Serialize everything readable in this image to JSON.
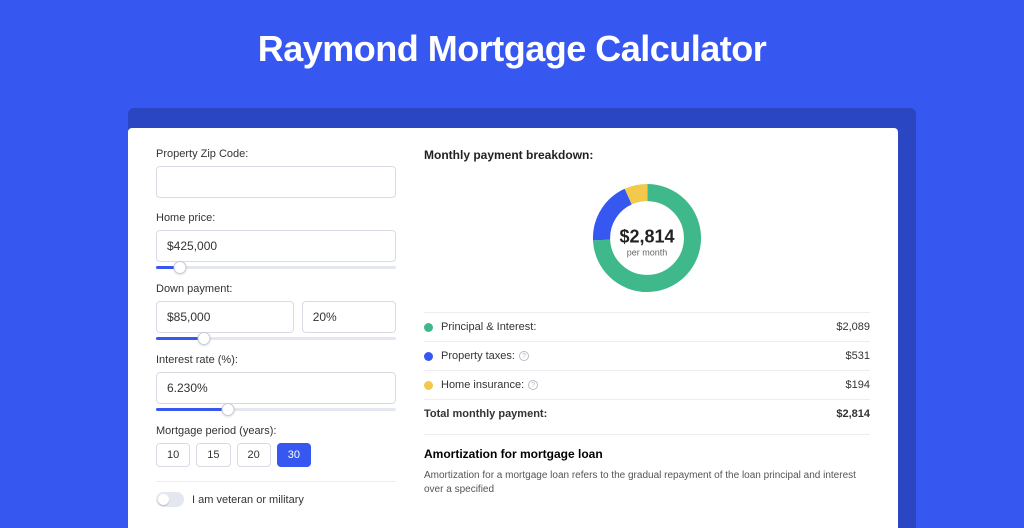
{
  "title": "Raymond Mortgage Calculator",
  "colors": {
    "accent": "#3657f0",
    "principal": "#3fb98b",
    "taxes": "#3657f0",
    "insurance": "#f3c94c"
  },
  "form": {
    "zip_label": "Property Zip Code:",
    "zip_value": "",
    "home_price_label": "Home price:",
    "home_price_value": "$425,000",
    "home_price_slider_pct": 10,
    "down_label": "Down payment:",
    "down_amount": "$85,000",
    "down_pct": "20%",
    "down_slider_pct": 20,
    "rate_label": "Interest rate (%):",
    "rate_value": "6.230%",
    "rate_slider_pct": 30,
    "period_label": "Mortgage period (years):",
    "periods": [
      "10",
      "15",
      "20",
      "30"
    ],
    "period_active_index": 3,
    "veteran_label": "I am veteran or military",
    "veteran_on": false
  },
  "breakdown": {
    "heading": "Monthly payment breakdown:",
    "center_amount": "$2,814",
    "center_sub": "per month",
    "items": [
      {
        "label": "Principal & Interest:",
        "value": "$2,089",
        "color": "#3fb98b",
        "has_info": false
      },
      {
        "label": "Property taxes:",
        "value": "$531",
        "color": "#3657f0",
        "has_info": true
      },
      {
        "label": "Home insurance:",
        "value": "$194",
        "color": "#f3c94c",
        "has_info": true
      }
    ],
    "total_label": "Total monthly payment:",
    "total_value": "$2,814"
  },
  "chart_data": {
    "type": "pie",
    "title": "Monthly payment breakdown:",
    "series": [
      {
        "name": "Principal & Interest",
        "value": 2089,
        "color": "#3fb98b"
      },
      {
        "name": "Property taxes",
        "value": 531,
        "color": "#3657f0"
      },
      {
        "name": "Home insurance",
        "value": 194,
        "color": "#f3c94c"
      }
    ],
    "total": 2814,
    "center_label": "$2,814 per month"
  },
  "amortization": {
    "heading": "Amortization for mortgage loan",
    "text": "Amortization for a mortgage loan refers to the gradual repayment of the loan principal and interest over a specified"
  }
}
